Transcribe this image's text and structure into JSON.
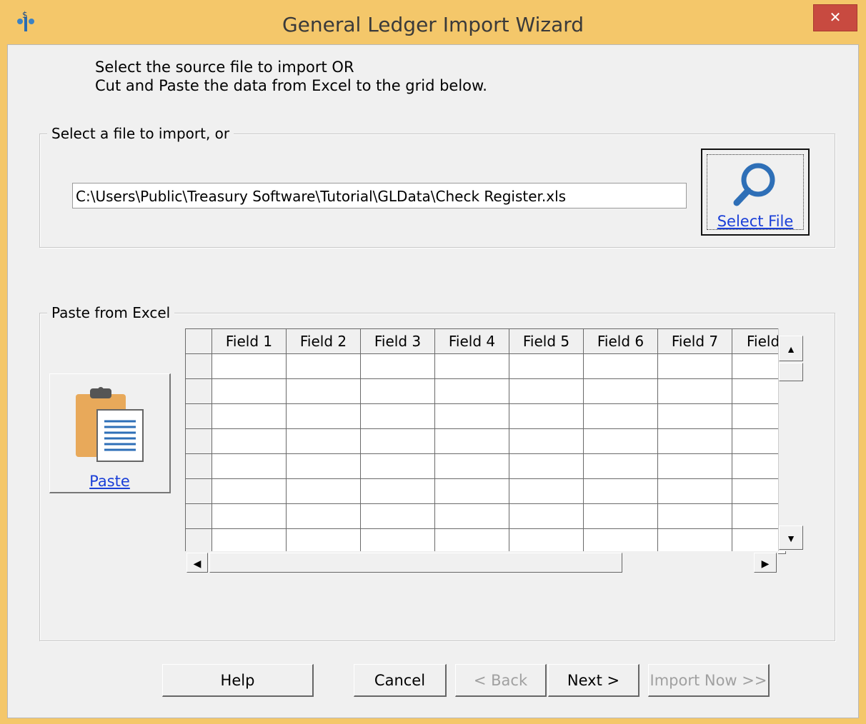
{
  "window": {
    "title": "General Ledger Import Wizard",
    "close_glyph": "✕"
  },
  "intro": {
    "line1": "Select the source file to import OR",
    "line2": "Cut and Paste the data from Excel to the grid below."
  },
  "file_group": {
    "legend": "Select a file to import, or",
    "path_value": "C:\\Users\\Public\\Treasury Software\\Tutorial\\GLData\\Check Register.xls",
    "select_button": "Select File"
  },
  "paste_group": {
    "legend": "Paste from Excel",
    "paste_button": "Paste"
  },
  "grid": {
    "columns": [
      "Field 1",
      "Field 2",
      "Field 3",
      "Field 4",
      "Field 5",
      "Field 6",
      "Field 7",
      "Field"
    ],
    "row_count": 8
  },
  "buttons": {
    "help": "Help",
    "cancel": "Cancel",
    "back": "< Back",
    "next": "Next >",
    "import_now": "Import Now >>"
  },
  "icons": {
    "app": "dollar-tree-icon",
    "select": "magnifier-icon",
    "paste": "clipboard-icon"
  }
}
